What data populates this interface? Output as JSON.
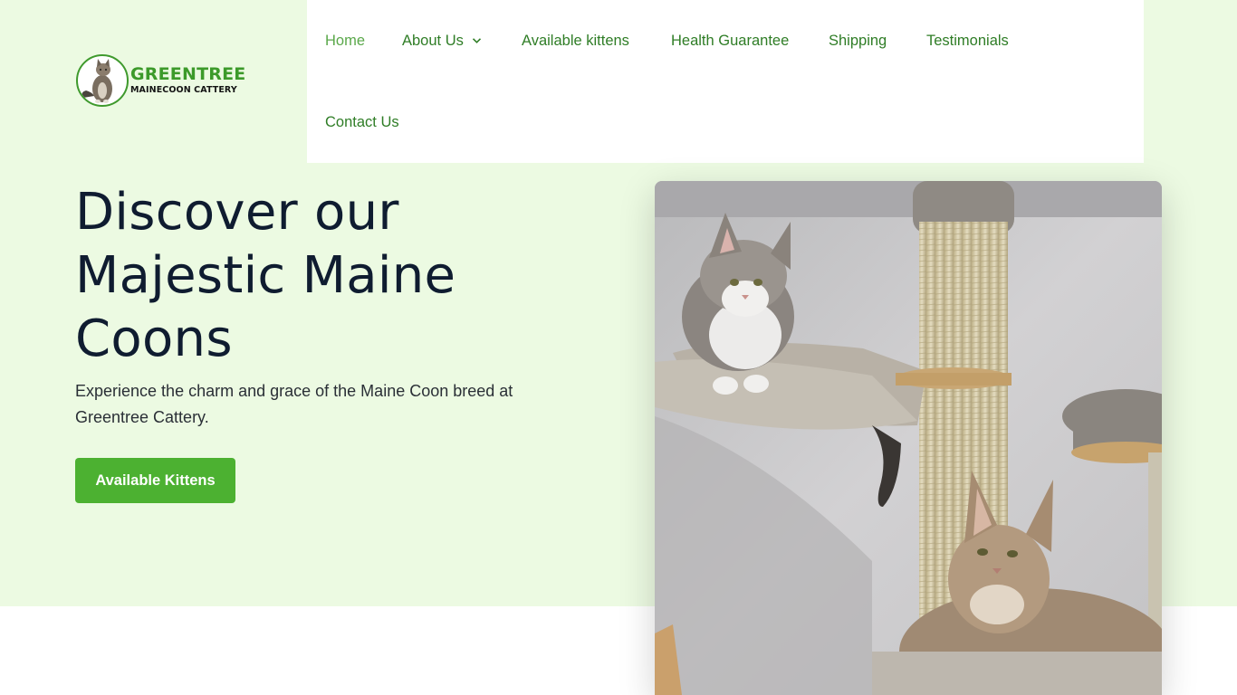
{
  "logo": {
    "title": "GREENTREE",
    "subtitle": "MAINECOON CATTERY"
  },
  "nav": {
    "items": [
      {
        "label": "Home",
        "active": true
      },
      {
        "label": "About Us",
        "has_dropdown": true,
        "icon": "chevron-down-icon"
      },
      {
        "label": "Available kittens"
      },
      {
        "label": "Health Guarantee"
      },
      {
        "label": "Shipping"
      },
      {
        "label": "Testimonials"
      },
      {
        "label": "Contact Us"
      }
    ]
  },
  "hero": {
    "title_lines": [
      "Discover our",
      "Majestic Maine",
      "Coons"
    ],
    "description": "Experience the charm and grace of the Maine Coon breed at Greentree Cattery.",
    "cta_label": "Available Kittens"
  },
  "colors": {
    "hero_background": "#ecfae2",
    "brand_green": "#4cb131",
    "nav_link": "#2f7d26",
    "nav_active": "#5aa84a",
    "heading": "#0f1c30"
  }
}
